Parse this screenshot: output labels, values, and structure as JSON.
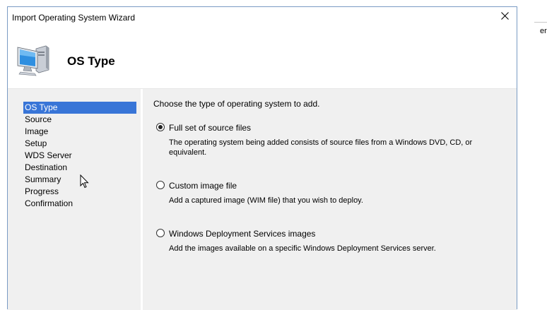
{
  "background": {
    "right_text": "er"
  },
  "dialog": {
    "title": "Import Operating System Wizard",
    "close_icon": "close-icon",
    "header": {
      "icon": "computer-icon",
      "title": "OS Type"
    },
    "nav": {
      "items": [
        {
          "label": "OS Type",
          "active": true
        },
        {
          "label": "Source"
        },
        {
          "label": "Image"
        },
        {
          "label": "Setup"
        },
        {
          "label": "WDS Server"
        },
        {
          "label": "Destination"
        },
        {
          "label": "Summary"
        },
        {
          "label": "Progress"
        },
        {
          "label": "Confirmation"
        }
      ]
    },
    "content": {
      "prompt": "Choose the type of operating system to add.",
      "options": [
        {
          "label": "Full set of source files",
          "description": "The operating system being added consists of source files from a Windows DVD, CD, or equivalent.",
          "selected": true
        },
        {
          "label": "Custom image file",
          "description": "Add a captured image (WIM file) that you wish to deploy.",
          "selected": false
        },
        {
          "label": "Windows Deployment Services images",
          "description": "Add the images available on a specific Windows Deployment Services server.",
          "selected": false
        }
      ]
    },
    "colors": {
      "selection": "#3875d7",
      "body_background": "#f0f0f0"
    }
  }
}
